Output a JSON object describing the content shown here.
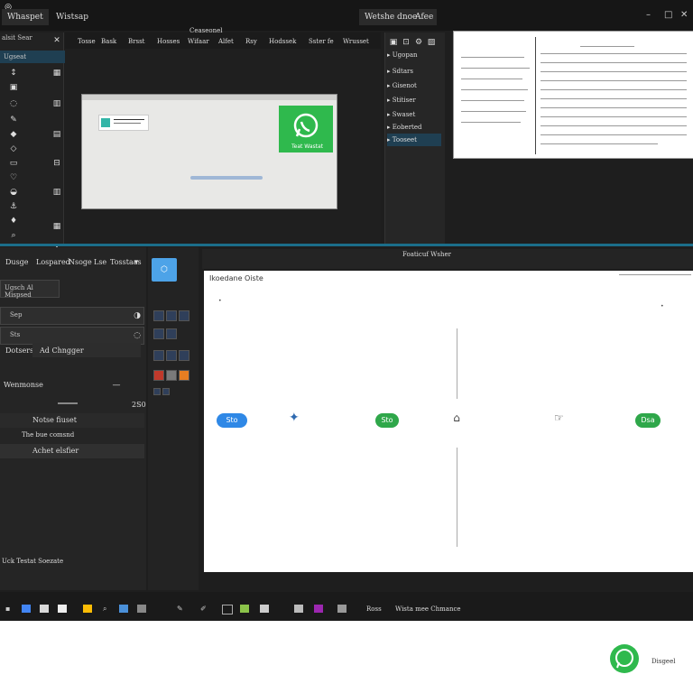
{
  "titlebar": {
    "tabs": [
      "Whaspet",
      "Wistsap"
    ],
    "right_tabs": [
      "Wetshe dnoe",
      "Afee"
    ],
    "controls": [
      "–",
      "□",
      "✕"
    ]
  },
  "left_toolbar": {
    "header": "alsit Sear",
    "selected": "Ugseat"
  },
  "document_tabs": {
    "title": "Ceaseonel",
    "items": [
      "Tosse",
      "Bask",
      "Brsst",
      "Hosses",
      "Wifaar",
      "Alfet",
      "Rsy",
      "Hodssek",
      "Sster fe",
      "Wrusset"
    ]
  },
  "canvas": {
    "card_label": "Teat Wastat",
    "accent": "#2fb94d"
  },
  "layers_panel": {
    "items": [
      "Ugopan",
      "Sdtars",
      "Gisenot",
      "Stitiser",
      "Swaset",
      "Eoberted",
      "Tooseet"
    ]
  },
  "bottom_left_panel": {
    "tabs": [
      "Dusge",
      "Lospared",
      "Nsoge",
      "Lse",
      "Tosstaas"
    ],
    "field1": "Ugsch Al Mispsed",
    "field2": "Sep",
    "field3": "Sts",
    "section_tabs": [
      "Dotsers",
      "Ad Chngger"
    ],
    "section_header": "Wenmonse",
    "value": "2S0",
    "list": [
      "Notse fiuset",
      "The bue comsnd",
      "Achet elsfier"
    ],
    "footer": "Uck Testat Soezate"
  },
  "main_panel": {
    "title": "Foaticuf Wsher",
    "page_title": "Ikoedane Oiste",
    "pills": [
      {
        "label": "Sto",
        "color": "#2f88e6"
      },
      {
        "label": "Sto",
        "color": "#2fa74a"
      },
      {
        "label": "Dsa",
        "color": "#2fa74a"
      }
    ]
  },
  "taskbar": {
    "text1": "Ross",
    "text2": "Wista mee Chmance"
  },
  "bottom_window": {
    "logo_label": "Disgeel"
  }
}
